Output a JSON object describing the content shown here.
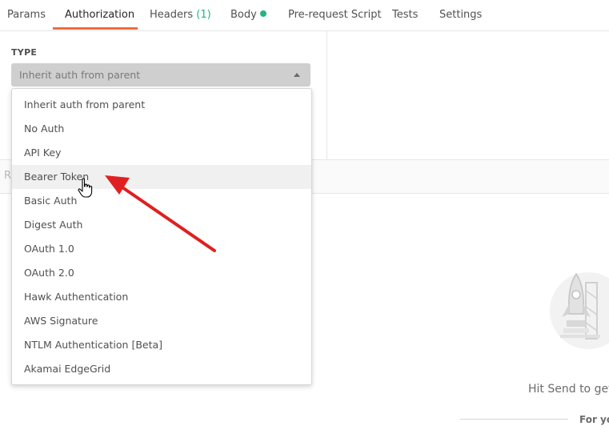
{
  "tabs": [
    {
      "label": "Params"
    },
    {
      "label": "Authorization"
    },
    {
      "label": "Headers",
      "count": "(1)"
    },
    {
      "label": "Body"
    },
    {
      "label": "Pre-request Script"
    },
    {
      "label": "Tests"
    },
    {
      "label": "Settings"
    }
  ],
  "auth": {
    "type_label": "TYPE",
    "selected": "Inherit auth from parent",
    "options": [
      "Inherit auth from parent",
      "No Auth",
      "API Key",
      "Bearer Token",
      "Basic Auth",
      "Digest Auth",
      "OAuth 1.0",
      "OAuth 2.0",
      "Hawk Authentication",
      "AWS Signature",
      "NTLM Authentication [Beta]",
      "Akamai EdgeGrid"
    ],
    "hovered_option": "Bearer Token"
  },
  "response": {
    "section_letter": "R",
    "hint": "Hit Send to get a",
    "hint_secondary": "For yo"
  },
  "colors": {
    "accent": "#f26b3a",
    "success": "#26b47f",
    "annotation_arrow": "#e02020"
  },
  "icons": {
    "body_status": "green-dot-icon",
    "select_caret": "caret-up-icon",
    "cursor": "hand-pointer-icon",
    "illustration": "rocket-launch-icon"
  }
}
